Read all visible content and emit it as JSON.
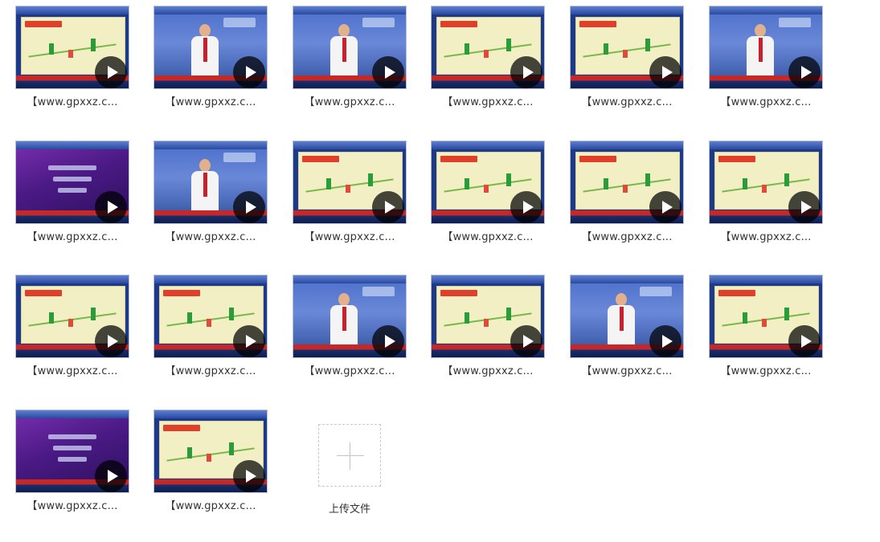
{
  "files": [
    {
      "name": "【www.gpxxz.c...",
      "kind": "chart"
    },
    {
      "name": "【www.gpxxz.c...",
      "kind": "studio"
    },
    {
      "name": "【www.gpxxz.c...",
      "kind": "studio"
    },
    {
      "name": "【www.gpxxz.c...",
      "kind": "chart"
    },
    {
      "name": "【www.gpxxz.c...",
      "kind": "chart"
    },
    {
      "name": "【www.gpxxz.c...",
      "kind": "studio"
    },
    {
      "name": "【www.gpxxz.c...",
      "kind": "title"
    },
    {
      "name": "【www.gpxxz.c...",
      "kind": "studio"
    },
    {
      "name": "【www.gpxxz.c...",
      "kind": "chart"
    },
    {
      "name": "【www.gpxxz.c...",
      "kind": "chart"
    },
    {
      "name": "【www.gpxxz.c...",
      "kind": "chart"
    },
    {
      "name": "【www.gpxxz.c...",
      "kind": "chart"
    },
    {
      "name": "【www.gpxxz.c...",
      "kind": "chart"
    },
    {
      "name": "【www.gpxxz.c...",
      "kind": "chart"
    },
    {
      "name": "【www.gpxxz.c...",
      "kind": "studio"
    },
    {
      "name": "【www.gpxxz.c...",
      "kind": "chart"
    },
    {
      "name": "【www.gpxxz.c...",
      "kind": "studio"
    },
    {
      "name": "【www.gpxxz.c...",
      "kind": "chart"
    },
    {
      "name": "【www.gpxxz.c...",
      "kind": "title"
    },
    {
      "name": "【www.gpxxz.c...",
      "kind": "chart"
    }
  ],
  "upload": {
    "label": "上传文件",
    "icon": "plus-icon"
  },
  "icons": {
    "play": "play-icon"
  },
  "colors": {
    "caption": "#333333",
    "upload_border": "#c9c9c9"
  }
}
